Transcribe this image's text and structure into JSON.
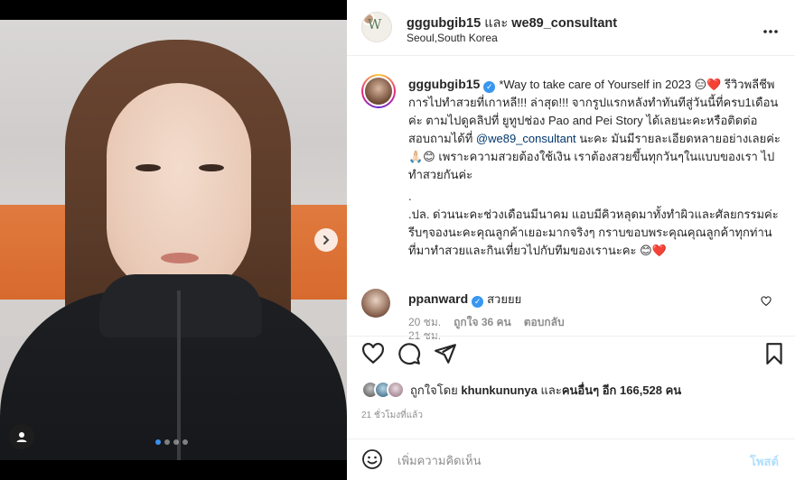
{
  "header": {
    "user1": "gggubgib15",
    "and": "และ",
    "user2": "we89_consultant",
    "location": "Seoul,South Korea",
    "avatar_letter": "W",
    "more_icon": "more-horizontal-icon"
  },
  "caption": {
    "username": "gggubgib15",
    "part1": "*Way to take care of Yourself in 2023 😑❤️ รีวิวพลีชีพ การไปทำสวยที่เกาหลี!!! ล่าสุด!!! จากรูปแรกหลังทำทันทีสู่วันนี้ที่ครบ1เดือนค่ะ ตามไปดูคลิปที่ ยูทูปช่อง Pao and Pei Story ได้เลยนะคะหรือติดต่อสอบถามได้ที่ ",
    "mention": "@we89_consultant",
    "part2": " นะคะ มันมีรายละเอียดหลายอย่างเลยค่ะ 🙏🏻😊 เพราะความสวยต้องใช้เงิน เราต้องสวยขึ้นทุกวันๆในแบบของเรา ไปทำสวยกันค่ะ",
    "dot": ".",
    "part3": ".ปล. ด่วนนะคะช่วงเดือนมีนาคม แอบมีคิวหลุดมาทั้งทำผิวและศัลยกรรมค่ะ รีบๆจองนะคะคุณลูกค้าเยอะมากจริงๆ กราบขอบพระคุณคุณลูกค้าทุกท่านที่มาทำสวยและกินเที่ยวไปกับทีมของเรานะคะ 😊❤️",
    "time": "21 ชม."
  },
  "comment": {
    "username": "ppanward",
    "text": "สวยยย",
    "time": "20 ชม.",
    "likes": "ถูกใจ 36 คน",
    "reply": "ตอบกลับ"
  },
  "likes": {
    "prefix": "ถูกใจโดย",
    "user": "khunkununya",
    "mid": "และ",
    "others": "คนอื่นๆ อีก 166,528 คน"
  },
  "post_time": "21 ชั่วโมงที่แล้ว",
  "comment_box": {
    "placeholder": "เพิ่มความคิดเห็น",
    "post_label": "โพสต์"
  },
  "carousel": {
    "count": 4,
    "active": 0
  },
  "colors": {
    "link": "#00376b",
    "verified": "#3897f0",
    "post_button": "#b2dffc",
    "active_dot": "#3a8ff0"
  }
}
